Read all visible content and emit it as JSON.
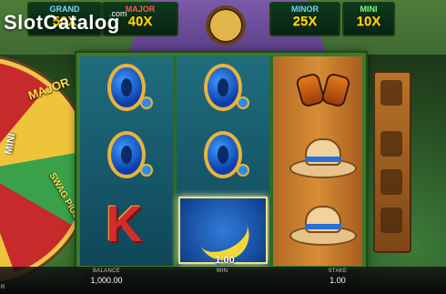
{
  "logo": {
    "text": "SlotCatalog",
    "suffix": ".com"
  },
  "jackpots": [
    {
      "label": "GRAND",
      "value": "50X"
    },
    {
      "label": "MAJOR",
      "value": "40X"
    },
    {
      "label": "MINOR",
      "value": "25X"
    },
    {
      "label": "MINI",
      "value": "10X"
    }
  ],
  "wheel": {
    "labels": [
      "MAJOR",
      "MINI",
      "SWAG PIGS"
    ]
  },
  "reels": {
    "reel1": [
      "Q",
      "Q",
      "K"
    ],
    "reel2": [
      "Q",
      "Q",
      "banana"
    ],
    "reel3": [
      "binoculars",
      "hat",
      "hat"
    ]
  },
  "win_cell": {
    "amount": "1.00"
  },
  "bottom_bar": {
    "balance_label": "BALANCE",
    "balance_value": "1,000.00",
    "win_label": "WIN",
    "win_value": "",
    "stake_label": "STAKE",
    "stake_value": "1.00",
    "corner": "R"
  },
  "colors": {
    "jackpot_value": "#ffd900",
    "reel_bg": "#0f4658",
    "frame": "#3c7a2a"
  }
}
